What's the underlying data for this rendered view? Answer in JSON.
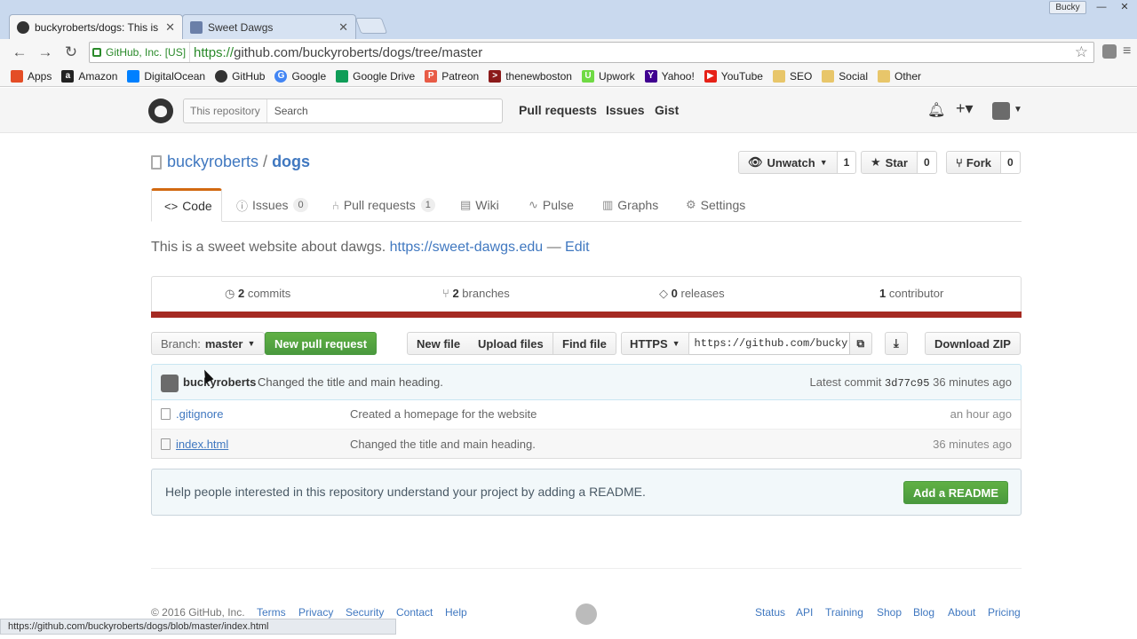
{
  "browser": {
    "tabs": [
      {
        "title": "buckyroberts/dogs: This is",
        "active": true
      },
      {
        "title": "Sweet Dawgs",
        "active": false
      }
    ],
    "profile": "Bucky",
    "ev_badge": "GitHub, Inc. [US]",
    "url_proto": "https://",
    "url_rest": "github.com/buckyroberts/dogs/tree/master",
    "bookmarks": [
      {
        "label": "Apps",
        "icon": "apps-grid-icon",
        "color": "#e44d26"
      },
      {
        "label": "Amazon",
        "icon": "amazon-icon",
        "color": "#222222"
      },
      {
        "label": "DigitalOcean",
        "icon": "cloud-icon",
        "color": "#0080ff"
      },
      {
        "label": "GitHub",
        "icon": "github-icon",
        "color": "#333333"
      },
      {
        "label": "Google",
        "icon": "google-icon",
        "color": "#4285f4"
      },
      {
        "label": "Google Drive",
        "icon": "drive-icon",
        "color": "#0f9d58"
      },
      {
        "label": "Patreon",
        "icon": "patreon-icon",
        "color": "#e85b46"
      },
      {
        "label": "thenewboston",
        "icon": "thenewboston-icon",
        "color": "#8b1a1a"
      },
      {
        "label": "Upwork",
        "icon": "upwork-icon",
        "color": "#6fda44"
      },
      {
        "label": "Yahoo!",
        "icon": "yahoo-icon",
        "color": "#400090"
      },
      {
        "label": "YouTube",
        "icon": "youtube-icon",
        "color": "#e62117"
      },
      {
        "label": "SEO",
        "icon": "folder-icon",
        "color": "#e8c66a"
      },
      {
        "label": "Social",
        "icon": "folder-icon",
        "color": "#e8c66a"
      },
      {
        "label": "Other",
        "icon": "folder-icon",
        "color": "#e8c66a"
      }
    ],
    "status_url": "https://github.com/buckyroberts/dogs/blob/master/index.html"
  },
  "header": {
    "search_scope": "This repository",
    "search_placeholder": "Search",
    "nav": [
      "Pull requests",
      "Issues",
      "Gist"
    ]
  },
  "repo": {
    "owner": "buckyroberts",
    "separator": "/",
    "name": "dogs",
    "unwatch_label": "Unwatch",
    "watch_count": "1",
    "star_label": "Star",
    "star_count": "0",
    "fork_label": "Fork",
    "fork_count": "0",
    "tabs": [
      {
        "label": "Code",
        "icon": "code-icon",
        "count": ""
      },
      {
        "label": "Issues",
        "icon": "issue-icon",
        "count": "0"
      },
      {
        "label": "Pull requests",
        "icon": "pull-request-icon",
        "count": "1"
      },
      {
        "label": "Wiki",
        "icon": "book-icon",
        "count": ""
      },
      {
        "label": "Pulse",
        "icon": "pulse-icon",
        "count": ""
      },
      {
        "label": "Graphs",
        "icon": "graph-icon",
        "count": ""
      },
      {
        "label": "Settings",
        "icon": "gear-icon",
        "count": ""
      }
    ],
    "description": "This is a sweet website about dawgs.",
    "homepage": "https://sweet-dawgs.edu",
    "dash": "—",
    "edit": "Edit",
    "stats": [
      {
        "num": "2",
        "label": "commits",
        "icon": "history-icon"
      },
      {
        "num": "2",
        "label": "branches",
        "icon": "branch-icon"
      },
      {
        "num": "0",
        "label": "releases",
        "icon": "tag-icon"
      },
      {
        "num": "1",
        "label": "contributor",
        "icon": "people-icon"
      }
    ],
    "lang_color": "#a52a22"
  },
  "filebar": {
    "branch_prefix": "Branch:",
    "branch": "master",
    "new_pr": "New pull request",
    "new_file": "New file",
    "upload": "Upload files",
    "find": "Find file",
    "protocol": "HTTPS",
    "clone_url": "https://github.com/buckyroberts/dogs.git",
    "download": "Download ZIP"
  },
  "commit": {
    "author": "buckyroberts",
    "message": "Changed the title and main heading.",
    "latest_label": "Latest commit",
    "sha": "3d77c95",
    "age": "36 minutes ago"
  },
  "files": [
    {
      "name": ".gitignore",
      "message": "Created a homepage for the website",
      "age": "an hour ago"
    },
    {
      "name": "index.html",
      "message": "Changed the title and main heading.",
      "age": "36 minutes ago"
    }
  ],
  "readme": {
    "text": "Help people interested in this repository understand your project by adding a README.",
    "button": "Add a README"
  },
  "footer": {
    "copyright": "© 2016 GitHub, Inc.",
    "left_links": [
      "Terms",
      "Privacy",
      "Security",
      "Contact",
      "Help"
    ],
    "right_links": [
      "Status",
      "API",
      "Training",
      "Shop",
      "Blog",
      "About",
      "Pricing"
    ]
  }
}
